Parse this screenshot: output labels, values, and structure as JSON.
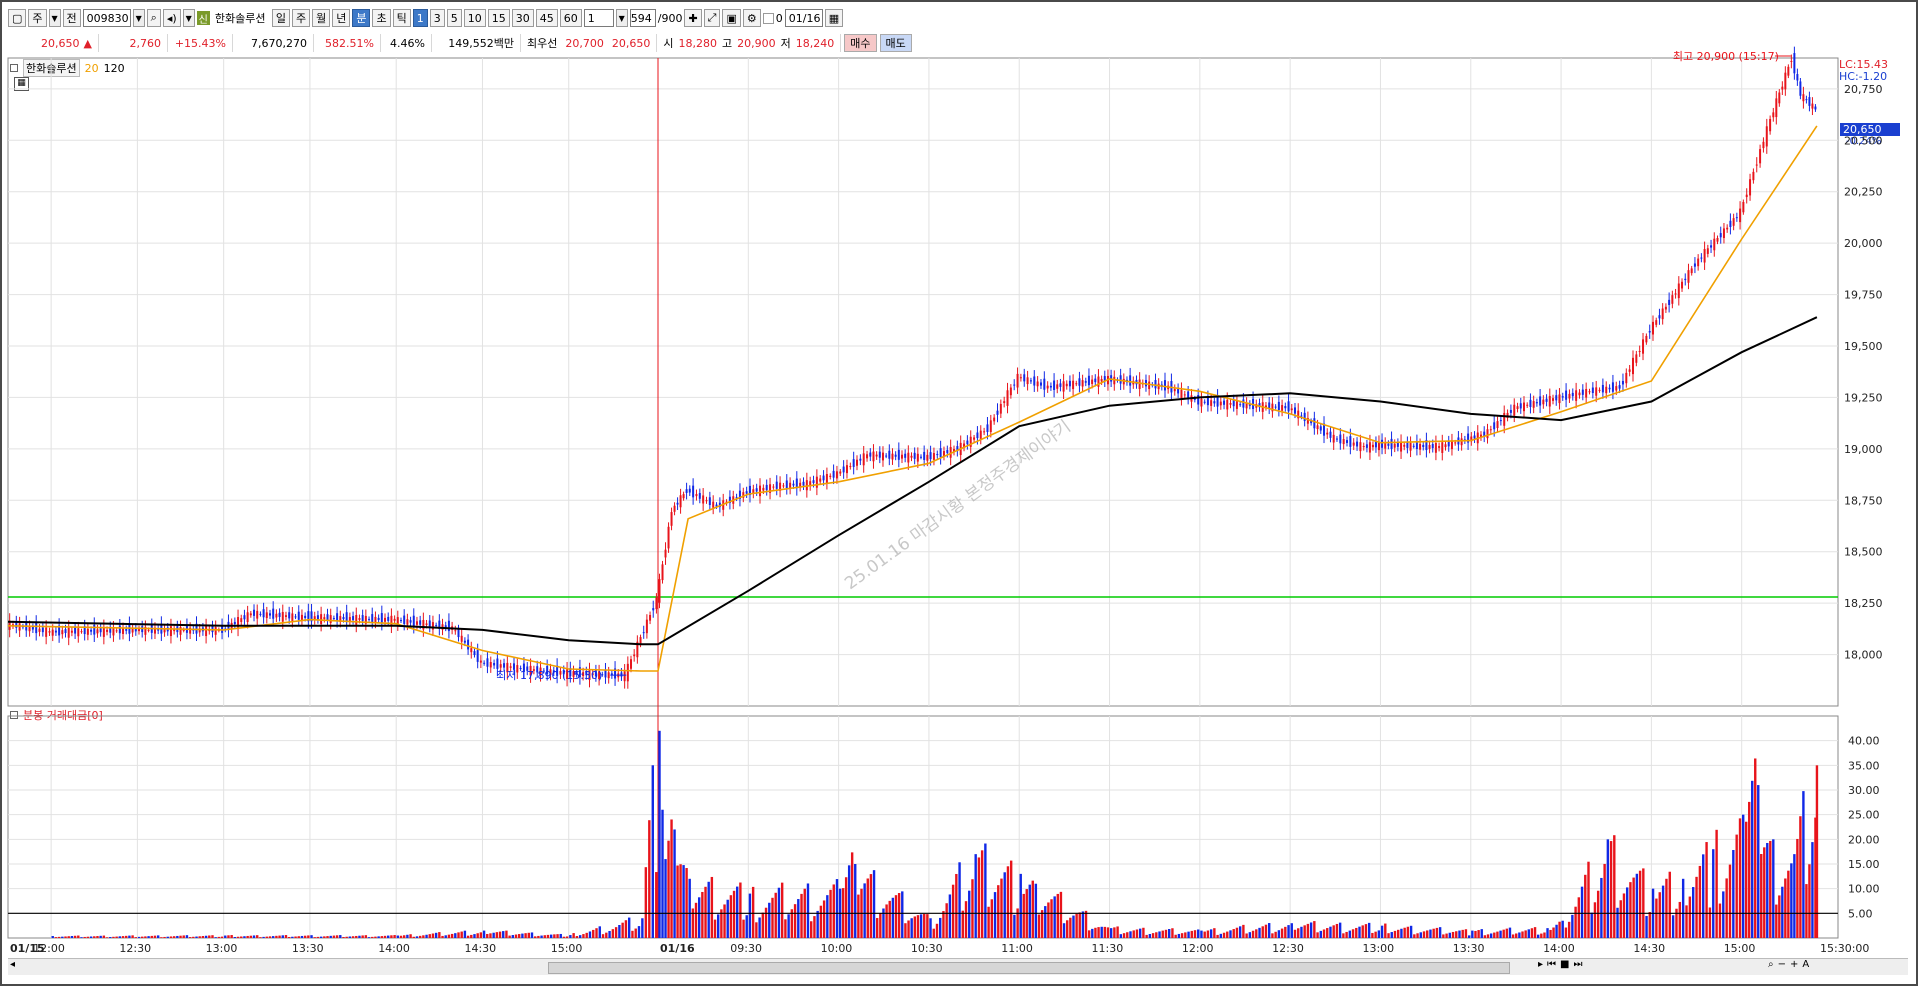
{
  "toolbar": {
    "market": "주",
    "prefix": "전",
    "code": "009830",
    "name_badge": "신",
    "name": "한화솔루션",
    "periods": [
      "일",
      "주",
      "월",
      "년",
      "분",
      "초",
      "틱"
    ],
    "selected_period": "분",
    "intervals": [
      "1",
      "3",
      "5",
      "10",
      "15",
      "30",
      "45",
      "60"
    ],
    "selected_interval": "1",
    "multiplier": "1",
    "count_current": "594",
    "count_total": "/900",
    "checkbox_label": "0",
    "date": "01/16"
  },
  "quote": {
    "price": "20,650",
    "change_arrow": "▲",
    "change": "2,760",
    "change_pct": "+15.43%",
    "volume": "7,670,270",
    "volume_ratio": "582.51%",
    "turnover_pct": "4.46%",
    "amount": "149,552백만",
    "best_ask_label": "최우선",
    "best_ask": "20,700",
    "best_bid": "20,650",
    "open_label": "시",
    "open": "18,280",
    "high_label": "고",
    "high": "20,900",
    "low_label": "저",
    "low": "18,240",
    "buy_label": "매수",
    "sell_label": "매도"
  },
  "price_panel": {
    "name": "한화솔루션",
    "ma_short": "20",
    "ma_long": "120",
    "lc": "LC:15.43",
    "hc": "HC:-1.20",
    "current_price": "20,650",
    "current_pct": "-0.24%",
    "high_annotation": "최고 20,900 (15:17)",
    "low_annotation": "최저 17,890 (15:30)",
    "watermark": "25.01.16 마감시황 본정주경제이야기",
    "colors": {
      "up": "#e8141b",
      "down": "#1028e6",
      "ma20": "#f0a000",
      "ma120": "#000000",
      "support": "#00cc00",
      "session": "#e8141b"
    }
  },
  "volume_panel": {
    "title": "분봉 거래대금[0]"
  },
  "chart_data": [
    {
      "type": "candlestick",
      "title": "한화솔루션",
      "ylim": [
        17750,
        20900
      ],
      "y_ticks": [
        "18,000",
        "18,250",
        "18,500",
        "18,750",
        "19,000",
        "19,250",
        "19,500",
        "19,750",
        "20,000",
        "20,250",
        "20,500",
        "20,750"
      ],
      "x_ticks": [
        "12:00",
        "12:30",
        "13:00",
        "13:30",
        "14:00",
        "14:30",
        "15:00",
        "01/16",
        "09:30",
        "10:00",
        "10:30",
        "11:00",
        "11:30",
        "12:00",
        "12:30",
        "13:00",
        "13:30",
        "14:00",
        "14:30",
        "15:00",
        "15:30:00"
      ],
      "x_tick_start_label": "01/15",
      "series": [
        {
          "name": "price",
          "x": [
            "01/15 11:45",
            "12:00",
            "12:30",
            "13:00",
            "13:10",
            "13:30",
            "14:00",
            "14:20",
            "14:30",
            "14:45",
            "15:00",
            "15:20",
            "01/16 09:00",
            "09:05",
            "09:10",
            "09:20",
            "09:30",
            "09:40",
            "09:50",
            "10:00",
            "10:10",
            "10:30",
            "10:40",
            "10:50",
            "11:00",
            "11:10",
            "11:30",
            "11:50",
            "12:00",
            "12:30",
            "12:45",
            "12:55",
            "13:00",
            "13:20",
            "13:35",
            "13:45",
            "14:00",
            "14:10",
            "14:20",
            "14:30",
            "14:45",
            "15:00",
            "15:10",
            "15:17",
            "15:20",
            "15:25"
          ],
          "y": [
            18150,
            18110,
            18120,
            18120,
            18200,
            18180,
            18170,
            18130,
            17960,
            17930,
            17910,
            17900,
            18270,
            18700,
            18800,
            18720,
            18790,
            18820,
            18830,
            18880,
            18970,
            18960,
            19000,
            19100,
            19350,
            19300,
            19340,
            19300,
            19230,
            19200,
            19050,
            19010,
            19020,
            19010,
            19070,
            19200,
            19250,
            19280,
            19300,
            19580,
            19900,
            20150,
            20600,
            20900,
            20720,
            20650
          ]
        },
        {
          "name": "20",
          "x": [
            "01/15 11:45",
            "13:00",
            "13:30",
            "14:00",
            "14:30",
            "15:00",
            "15:25",
            "01/16 09:00",
            "09:10",
            "09:30",
            "10:00",
            "10:30",
            "11:00",
            "11:30",
            "12:00",
            "12:30",
            "13:00",
            "13:30",
            "14:00",
            "14:30",
            "15:00",
            "15:25"
          ],
          "y": [
            18140,
            18120,
            18170,
            18150,
            18020,
            17930,
            17920,
            17920,
            18660,
            18780,
            18840,
            18930,
            19130,
            19340,
            19280,
            19170,
            19030,
            19040,
            19180,
            19330,
            20020,
            20570
          ]
        },
        {
          "name": "120",
          "x": [
            "01/15 11:45",
            "13:00",
            "14:00",
            "14:30",
            "15:00",
            "15:25",
            "01/16 09:00",
            "09:30",
            "10:00",
            "10:30",
            "11:00",
            "11:30",
            "12:00",
            "12:30",
            "13:00",
            "13:30",
            "14:00",
            "14:30",
            "15:00",
            "15:25"
          ],
          "y": [
            18160,
            18140,
            18140,
            18120,
            18070,
            18050,
            18050,
            18310,
            18580,
            18840,
            19110,
            19210,
            19250,
            19270,
            19230,
            19170,
            19140,
            19230,
            19470,
            19640
          ]
        }
      ],
      "support_line": 18280
    },
    {
      "type": "bar",
      "title": "분봉 거래대금[0]",
      "ylim": [
        0,
        45
      ],
      "y_ticks": [
        "5.00",
        "10.00",
        "15.00",
        "20.00",
        "25.00",
        "30.00",
        "35.00",
        "40.00"
      ],
      "reference_line": 5.0,
      "series": [
        {
          "name": "거래대금",
          "x": [
            "01/15 12:00",
            "13:00",
            "14:00",
            "14:30",
            "15:00",
            "15:25",
            "01/16 09:00",
            "09:01",
            "09:02",
            "09:05",
            "09:10",
            "09:30",
            "10:00",
            "10:05",
            "10:30",
            "10:45",
            "11:00",
            "11:05",
            "11:30",
            "12:00",
            "12:30",
            "13:00",
            "13:30",
            "13:55",
            "14:00",
            "14:15",
            "14:30",
            "14:40",
            "14:50",
            "15:00",
            "15:05",
            "15:10",
            "15:17",
            "15:25"
          ],
          "values": [
            0.4,
            0.5,
            0.5,
            1.5,
            0.6,
            4.0,
            42.0,
            26.0,
            16.0,
            22.0,
            12.0,
            9.0,
            10.0,
            15.0,
            4.0,
            17.0,
            13.0,
            11.0,
            2.0,
            1.5,
            3.0,
            2.5,
            1.5,
            2.0,
            3.5,
            20.0,
            10.0,
            12.0,
            18.0,
            25.0,
            31.0,
            20.0,
            17.0,
            35.0
          ]
        }
      ]
    }
  ]
}
